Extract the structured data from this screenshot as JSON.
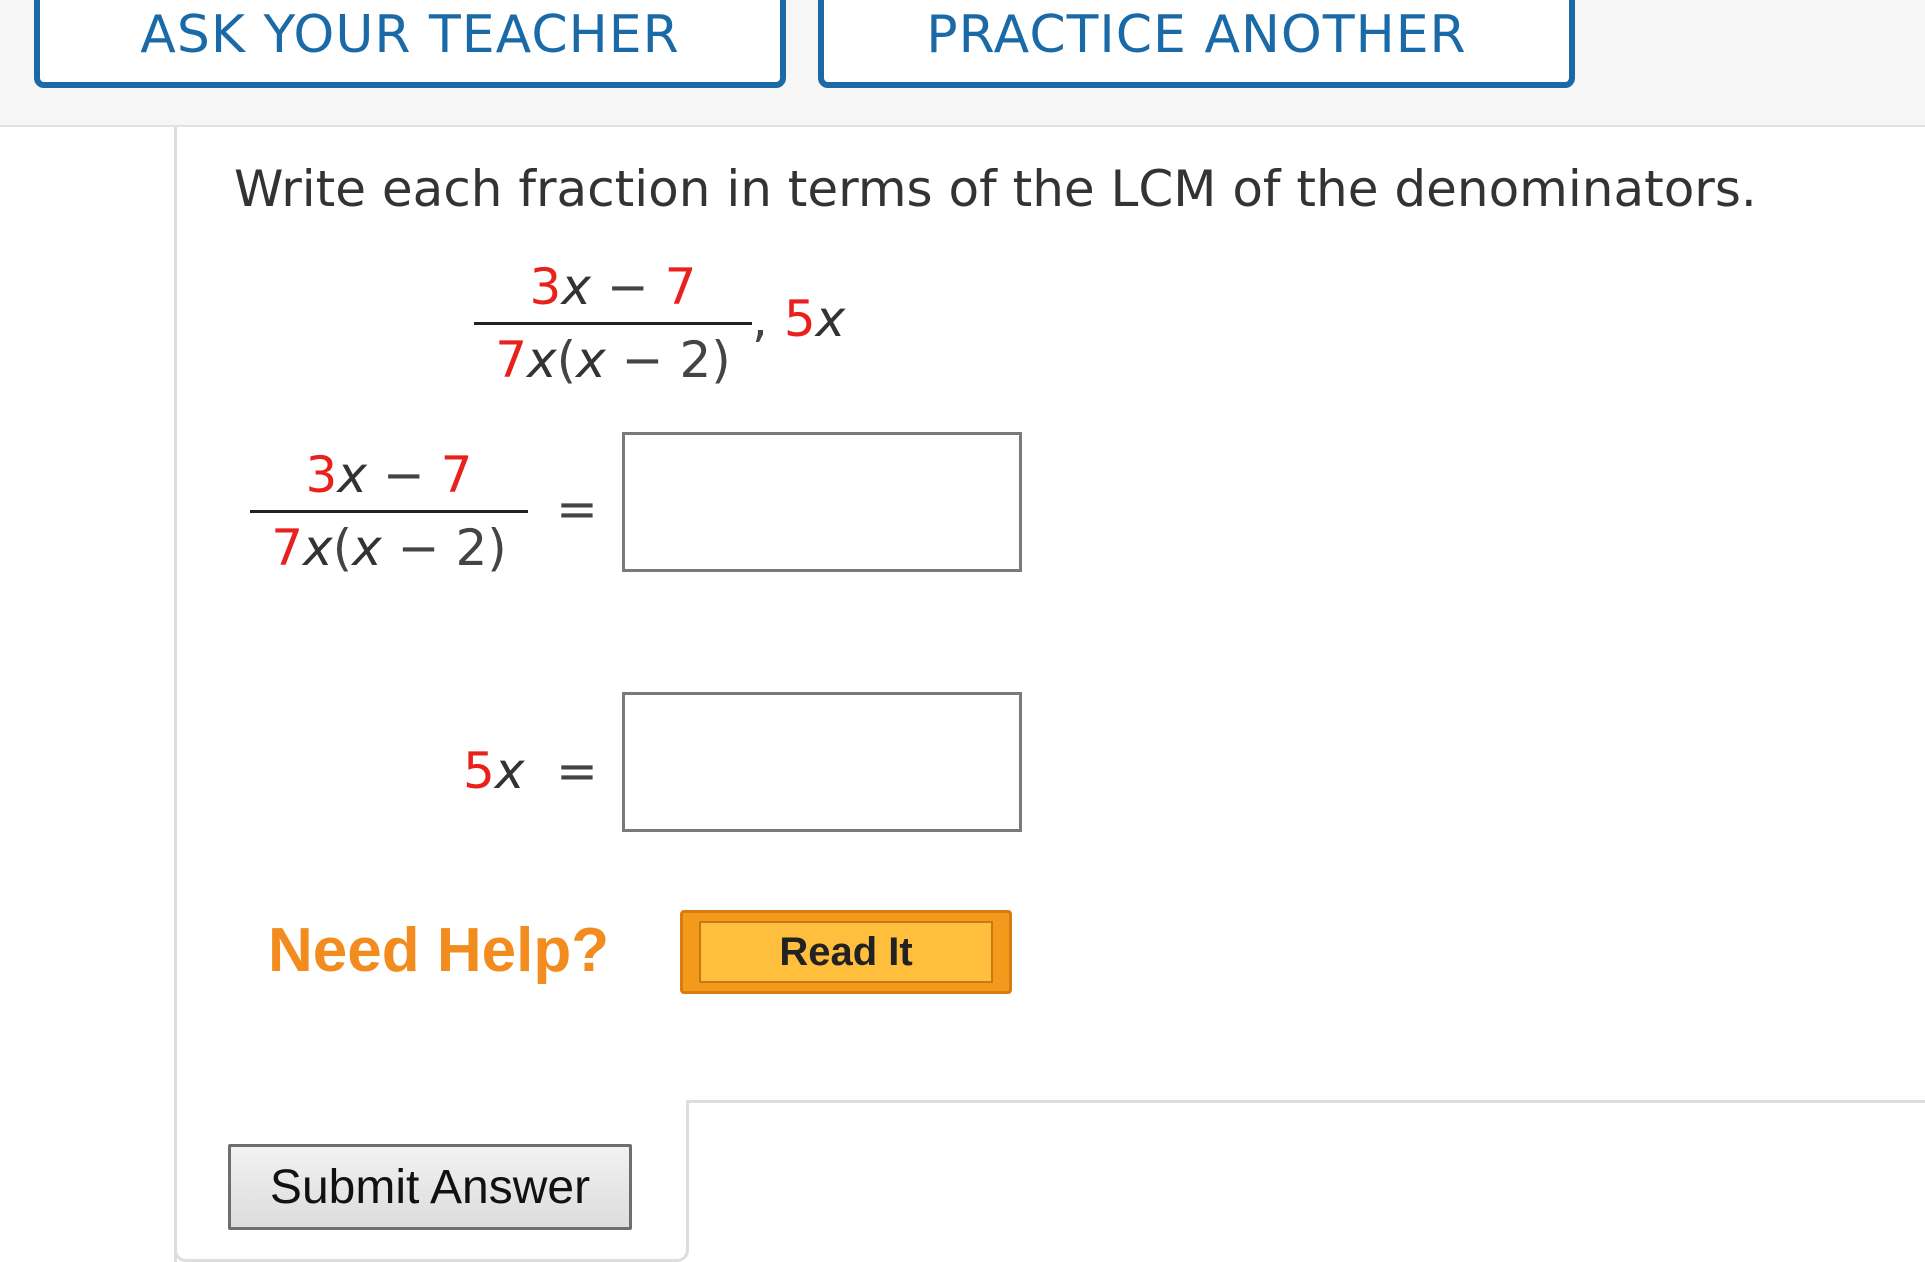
{
  "toolbar": {
    "ask_teacher_label": "ASK YOUR TEACHER",
    "practice_another_label": "PRACTICE ANOTHER"
  },
  "question": {
    "prompt": "Write each fraction in terms of the LCM of the denominators.",
    "given": {
      "fraction": {
        "numerator_coef": "3",
        "numerator_var": "x",
        "numerator_op": " − ",
        "numerator_const": "7",
        "denominator_coef": "7",
        "denominator_var": "x",
        "denominator_open": "(",
        "denominator_inner_var": "x",
        "denominator_op": " − ",
        "denominator_const": "2)"
      },
      "separator": ",",
      "second_coef": "5",
      "second_var": "x"
    },
    "equation_1": {
      "equals": "=",
      "answer_value": ""
    },
    "equation_2": {
      "lhs_coef": "5",
      "lhs_var": "x",
      "equals": "=",
      "answer_value": ""
    }
  },
  "help": {
    "label": "Need Help?",
    "read_it_label": "Read It"
  },
  "actions": {
    "submit_label": "Submit Answer"
  },
  "colors": {
    "accent_blue": "#1b6aa8",
    "math_red": "#e8211d",
    "help_orange": "#f28c1e",
    "read_it_fill": "#ffbe3c"
  }
}
